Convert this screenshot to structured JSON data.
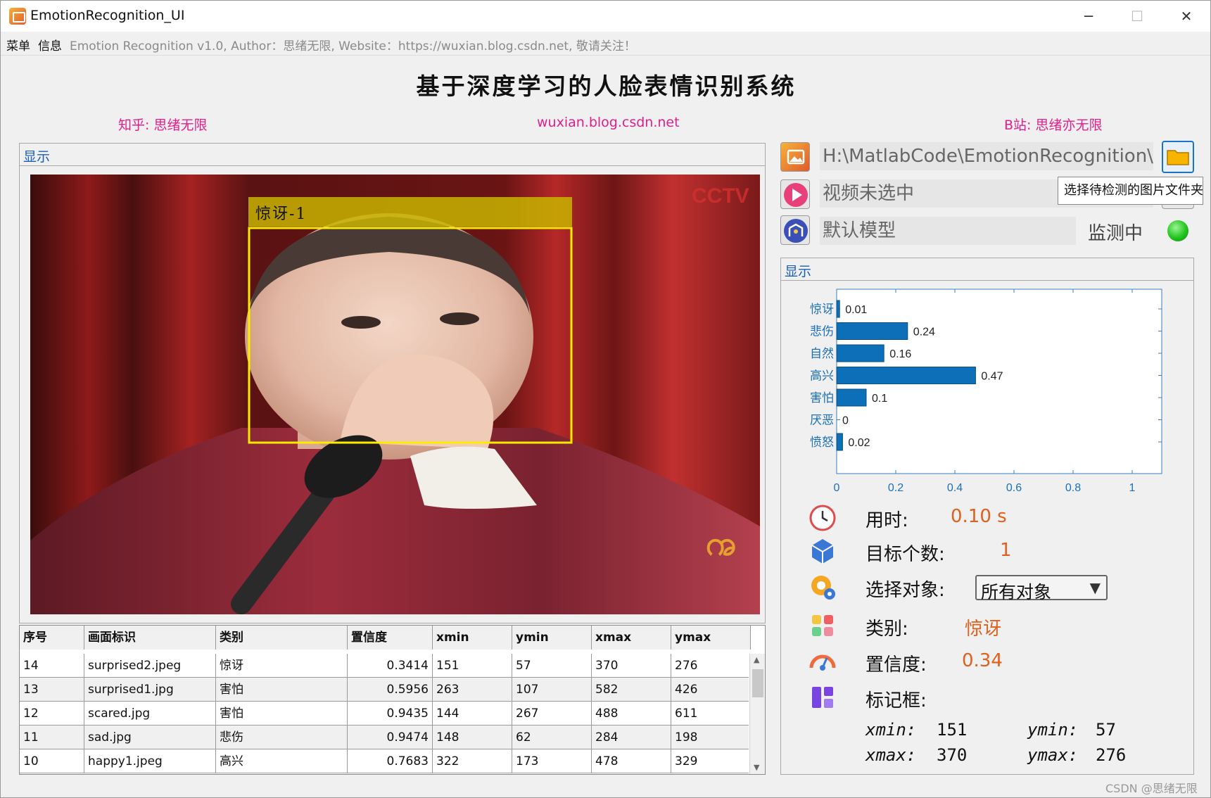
{
  "window": {
    "title": "EmotionRecognition_UI",
    "minimize": "─",
    "maximize": "☐",
    "close": "✕"
  },
  "menubar": {
    "menu_label": "菜单",
    "info_label": "信息",
    "about_text": "Emotion Recognition v1.0, Author：思绪无限, Website：https://wuxian.blog.csdn.net, 敬请关注！"
  },
  "header": {
    "title": "基于深度学习的人脸表情识别系统",
    "link_zhihu": "知乎: 思绪无限",
    "link_blog": "wuxian.blog.csdn.net",
    "link_bilibili": "B站: 思绪亦无限"
  },
  "left_panel": {
    "title": "显示",
    "detection_label": "惊讶-1",
    "logo_text": "CCTV"
  },
  "table": {
    "columns": [
      "序号",
      "画面标识",
      "类别",
      "置信度",
      "xmin",
      "ymin",
      "xmax",
      "ymax"
    ],
    "rows": [
      [
        "14",
        "surprised2.jpeg",
        "惊讶",
        "0.3414",
        "151",
        "57",
        "370",
        "276"
      ],
      [
        "13",
        "surprised1.jpg",
        "害怕",
        "0.5956",
        "263",
        "107",
        "582",
        "426"
      ],
      [
        "12",
        "scared.jpg",
        "害怕",
        "0.9435",
        "144",
        "267",
        "488",
        "611"
      ],
      [
        "11",
        "sad.jpg",
        "悲伤",
        "0.9474",
        "148",
        "62",
        "284",
        "198"
      ],
      [
        "10",
        "happy1.jpeg",
        "高兴",
        "0.7683",
        "322",
        "173",
        "478",
        "329"
      ]
    ]
  },
  "controls": {
    "image_path": "H:\\MatlabCode\\EmotionRecognition\\...",
    "video_status": "视频未选中",
    "model_name": "默认模型",
    "monitor_status": "监测中",
    "tooltip": "选择待检测的图片文件夹",
    "status_color": "#22c41e"
  },
  "right_panel": {
    "title": "显示"
  },
  "chart_data": {
    "type": "bar",
    "orientation": "horizontal",
    "categories": [
      "惊讶",
      "悲伤",
      "自然",
      "高兴",
      "害怕",
      "厌恶",
      "愤怒"
    ],
    "values": [
      0.01,
      0.24,
      0.16,
      0.47,
      0.1,
      0,
      0.02
    ],
    "value_labels": [
      "0.01",
      "0.24",
      "0.16",
      "0.47",
      "0.1",
      "0",
      "0.02"
    ],
    "xlim": [
      0,
      1.1
    ],
    "xticks": [
      "0",
      "0.2",
      "0.4",
      "0.6",
      "0.8",
      "1"
    ],
    "bar_color": "#0c6fb8"
  },
  "stats": {
    "time_label": "用时:",
    "time_value": "0.10 s",
    "count_label": "目标个数:",
    "count_value": "1",
    "select_label": "选择对象:",
    "select_value": "所有对象",
    "class_label": "类别:",
    "class_value": "惊讶",
    "conf_label": "置信度:",
    "conf_value": "0.34",
    "box_label": "标记框:",
    "xmin_label": "xmin:",
    "xmin_value": "151",
    "ymin_label": "ymin:",
    "ymin_value": "57",
    "xmax_label": "xmax:",
    "xmax_value": "370",
    "ymax_label": "ymax:",
    "ymax_value": "276"
  },
  "watermark": "CSDN @思绪无限"
}
